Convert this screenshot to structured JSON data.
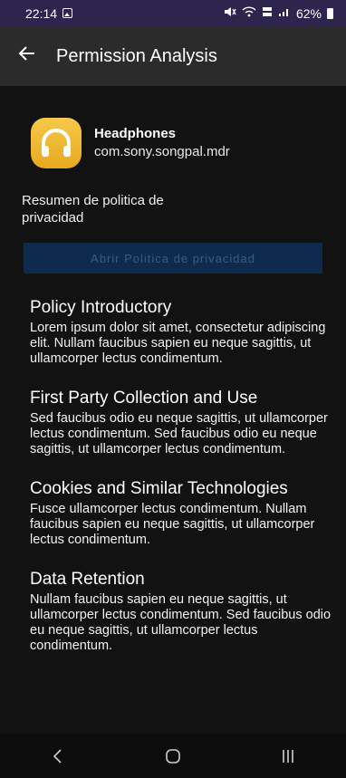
{
  "status_bar": {
    "time": "22:14",
    "battery": "62%",
    "icons": [
      "image-icon",
      "mute-icon",
      "wifi-icon",
      "volte-icon",
      "signal-icon",
      "battery-icon"
    ]
  },
  "app_bar": {
    "back_icon": "arrow-left-icon",
    "title": "Permission Analysis"
  },
  "app": {
    "name": "Headphones",
    "package": "com.sony.songpal.mdr",
    "icon": "headphones-icon"
  },
  "summary_label": "Resumen de politica de privacidad",
  "open_policy_button": "Abrir Politica de privacidad",
  "sections": [
    {
      "title": "Policy Introductory",
      "body": "Lorem ipsum dolor sit amet, consectetur adipiscing elit. Nullam faucibus sapien eu neque sagittis, ut ullamcorper lectus condimentum."
    },
    {
      "title": "First Party Collection and Use",
      "body": "Sed faucibus odio eu neque sagittis, ut ullamcorper lectus condimentum. Sed faucibus odio eu neque sagittis, ut ullamcorper lectus condimentum."
    },
    {
      "title": "Cookies and Similar Technologies",
      "body": "Fusce ullamcorper lectus condimentum. Nullam faucibus sapien eu neque sagittis, ut ullamcorper lectus condimentum."
    },
    {
      "title": "Data Retention",
      "body": "Nullam faucibus sapien eu neque sagittis, ut ullamcorper lectus condimentum. Sed faucibus odio eu neque sagittis, ut ullamcorper lectus condimentum."
    }
  ],
  "nav_bar": {
    "icons": [
      "back-nav-icon",
      "home-nav-icon",
      "recents-nav-icon"
    ]
  },
  "colors": {
    "status_bar": "#2e254f",
    "app_bar": "#2b2b2b",
    "background": "#121212",
    "button_bg": "#0e2a4c",
    "button_text": "#3b5a85",
    "app_icon": "#f6c94a"
  }
}
